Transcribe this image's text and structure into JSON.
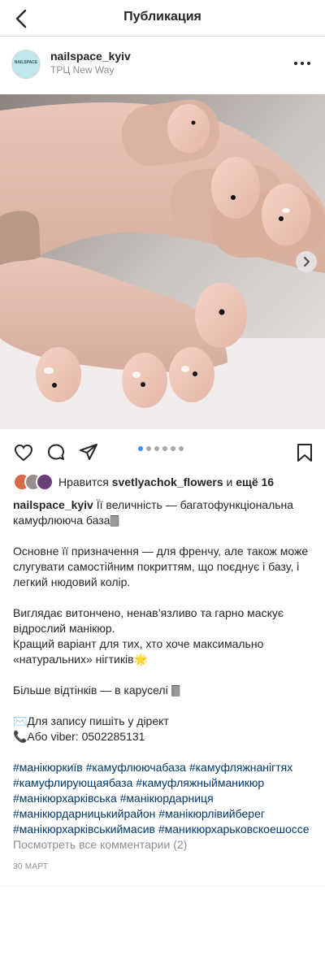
{
  "header": {
    "title": "Публикация"
  },
  "post": {
    "username": "nailspace_kyiv",
    "location": "ТРЦ New Way",
    "avatar_text": "NAILSPACE",
    "carousel": {
      "count": 6,
      "active_index": 0
    },
    "likes": {
      "prefix": "Нравится",
      "user": "svetlyachok_flowers",
      "and_more": "и",
      "more_count": "ещё 16"
    },
    "caption": {
      "first_line": "Її величність — багатофункціональна камуфлююча база🀫",
      "paragraphs": [
        "Основне її призначення — для френчу, але також може слугувати самостійним покриттям, що поєднує і базу, і легкий нюдовий колір.",
        "Виглядає витончено, ненав’язливо та гарно маскує відрослий манікюр.\nКращий варіант для тих, хто хоче максимально «натуральних» нігтиків🌟",
        "Більше відтінків — в каруселі 🀫",
        "✉️Для запису пишіть у дірект\n📞Або viber: 0502285131"
      ],
      "hashtags": "#манікюркиїв #камуфлюючабаза #камуфляжнанігтях #камуфлирующаябаза #камуфляжныйманикюр #манікюрхарківська #манікюрдарниця #манікюрдарницькийрайон #манікюрлівийберег #манікюрхарківськиймасив #маникюрхарьковскоешоссе"
    },
    "view_comments": "Посмотреть все комментарии (2)",
    "date": "30 МАРТ"
  },
  "colors": {
    "link": "#00376b",
    "muted": "#8e8e8e",
    "dot_active": "#3897f0",
    "dot_inactive": "#a8a8a8",
    "skin": "#e3bfb0",
    "nail": "#efc7ba"
  },
  "icons": {
    "back": "chevron-left-icon",
    "more": "more-dots-icon",
    "like": "heart-icon",
    "comment": "comment-bubble-icon",
    "share": "paper-plane-icon",
    "save": "bookmark-icon",
    "next": "chevron-right-icon"
  }
}
